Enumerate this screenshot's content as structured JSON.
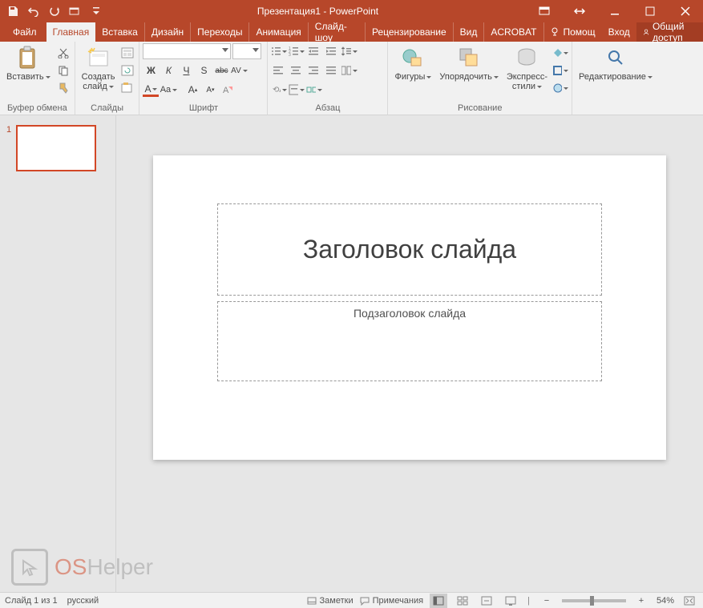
{
  "title": "Презентация1 - PowerPoint",
  "tabs": {
    "file": "Файл",
    "home": "Главная",
    "insert": "Вставка",
    "design": "Дизайн",
    "transitions": "Переходы",
    "animation": "Анимация",
    "slideshow": "Слайд-шоу",
    "review": "Рецензирование",
    "view": "Вид",
    "acrobat": "ACROBAT",
    "help": "Помощ",
    "signin": "Вход",
    "share": "Общий доступ"
  },
  "ribbon": {
    "clipboard": {
      "label": "Буфер обмена",
      "paste": "Вставить"
    },
    "slides": {
      "label": "Слайды",
      "new_slide": "Создать\nслайд"
    },
    "font": {
      "label": "Шрифт",
      "bold": "Ж",
      "italic": "К",
      "underline": "Ч",
      "shadow": "S",
      "strike": "abc",
      "spacing": "AV",
      "fontcolor": "A",
      "case": "Aa",
      "grow": "A",
      "shrink": "A"
    },
    "paragraph": {
      "label": "Абзац"
    },
    "drawing": {
      "label": "Рисование",
      "shapes": "Фигуры",
      "arrange": "Упорядочить",
      "styles": "Экспресс-\nстили"
    },
    "editing": {
      "label": "",
      "find": "Редактирование"
    }
  },
  "slide": {
    "title_placeholder": "Заголовок слайда",
    "subtitle_placeholder": "Подзаголовок слайда"
  },
  "thumbs": {
    "current": "1"
  },
  "status": {
    "slide_indicator": "Слайд 1 из 1",
    "language": "русский",
    "notes": "Заметки",
    "comments": "Примечания",
    "zoom": "54%"
  },
  "watermark": {
    "os": "OS",
    "helper": "Helper"
  }
}
